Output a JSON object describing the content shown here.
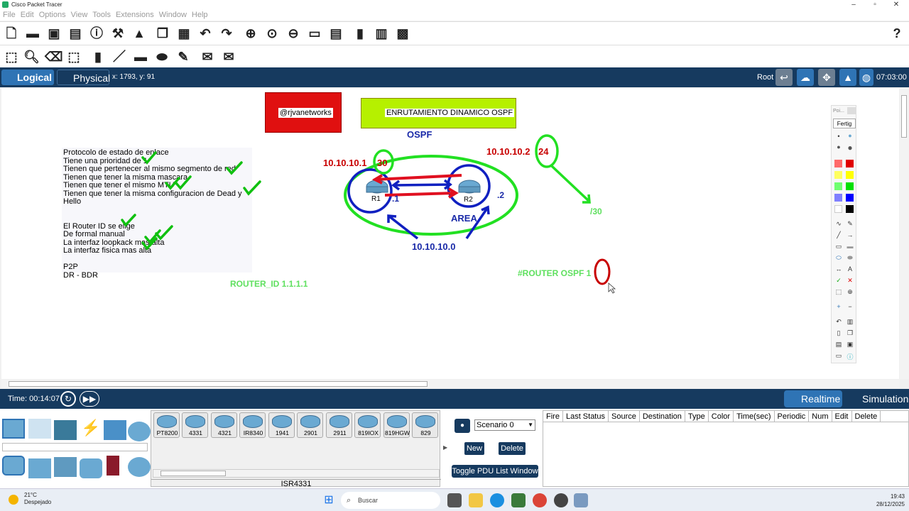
{
  "window": {
    "title": "Cisco Packet Tracer",
    "minimize": "–",
    "maximize": "▫",
    "close": "✕"
  },
  "menu": [
    "File",
    "Edit",
    "Options",
    "View",
    "Tools",
    "Extensions",
    "Window",
    "Help"
  ],
  "toolbar_help": "?",
  "nav": {
    "logical": "Logical",
    "physical": "Physical",
    "coords": "x: 1793, y: 91",
    "root": "Root",
    "clock": "07:03:00"
  },
  "canvas": {
    "note_lines": [
      "Protocolo de estado de enlace",
      "Tiene una prioridad de 1",
      "Tienen que pertenecer al  mismo segmento de red",
      "Tienen que tener la misma mascara",
      "Tienen que tener el mismo MTU",
      "Tienen que tener la misma configuracion de Dead y Hello",
      "",
      "El Router ID se elige",
      "De formal manual",
      "La interfaz loopkack mas alta",
      "La interfaz fisica mas alta",
      "",
      "P2P",
      "DR - BDR"
    ],
    "red_label": "@rjvanetworks",
    "green_label": "ENRUTAMIENTO DINAMICO OSPF",
    "ospf": "OSPF",
    "ip1": "10.10.10.1",
    "mask1": "30",
    "ip2": "10.10.10.2",
    "mask2": "24",
    "slash30": "/30",
    "dot1": ".1",
    "dot2": ".2",
    "area": "AREA",
    "network": "10.10.10.0",
    "r1": "R1",
    "r2": "R2",
    "router_id": "ROUTER_ID 1.1.1.1",
    "router_ospf": "#ROUTER OSPF 1"
  },
  "palette": {
    "title": "Poi...",
    "fertig": "Fertig",
    "colors": [
      "#ff6b6b",
      "#e00000",
      "#ffff60",
      "#ffff00",
      "#70ff70",
      "#00e000",
      "#8080ff",
      "#0000ff",
      "#ffffff",
      "#000000"
    ]
  },
  "bottom": {
    "time": "Time: 00:14:07",
    "realtime": "Realtime",
    "simulation": "Simulation",
    "devices": [
      "PT8200",
      "4331",
      "4321",
      "IR8340",
      "1941",
      "2901",
      "2911",
      "819IOX",
      "819HGW",
      "829"
    ],
    "selected_device": "ISR4331",
    "scenario": "Scenario 0",
    "new": "New",
    "delete": "Delete",
    "toggle": "Toggle PDU List Window",
    "pdu_columns": [
      "Fire",
      "Last Status",
      "Source",
      "Destination",
      "Type",
      "Color",
      "Time(sec)",
      "Periodic",
      "Num",
      "Edit",
      "Delete"
    ]
  },
  "taskbar": {
    "temp": "21°C",
    "weather": "Despejado",
    "search": "Buscar",
    "time": "19:43",
    "date": "28/12/2025"
  }
}
